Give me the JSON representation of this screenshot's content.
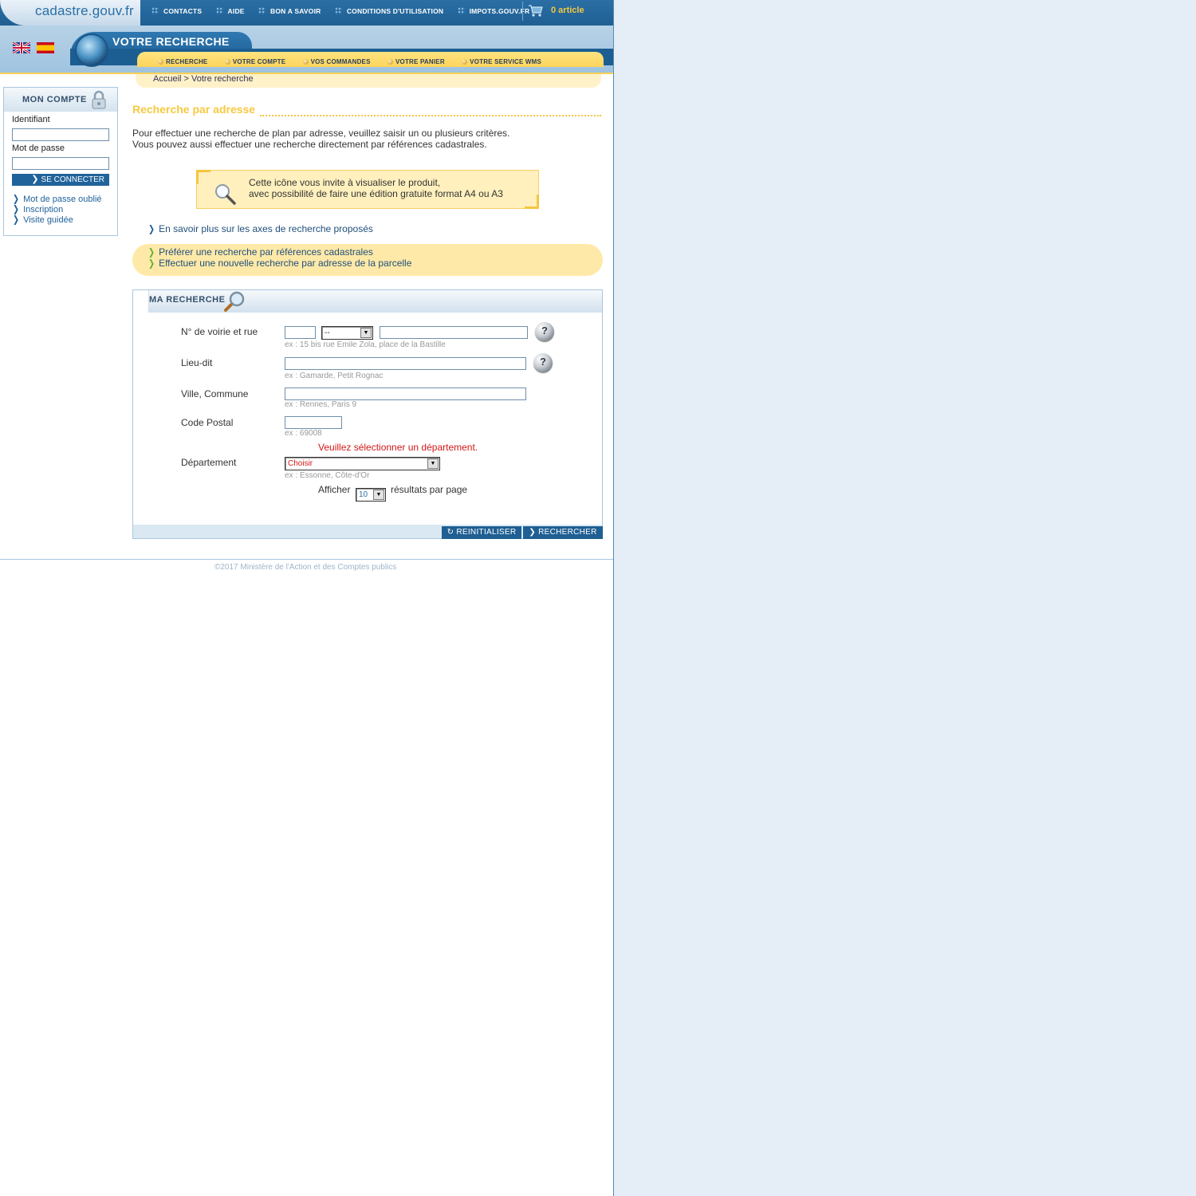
{
  "header": {
    "logo": "cadastre.gouv.fr",
    "top_nav": [
      "CONTACTS",
      "AIDE",
      "BON A SAVOIR",
      "CONDITIONS D'UTILISATION",
      "IMPOTS.GOUV.FR"
    ],
    "cart": "0 article",
    "section_title": "VOTRE RECHERCHE",
    "main_nav": [
      "RECHERCHE",
      "VOTRE COMPTE",
      "VOS COMMANDES",
      "VOTRE PANIER",
      "VOTRE SERVICE WMS"
    ],
    "breadcrumb": "Accueil > Votre recherche",
    "languages": [
      "English",
      "Español"
    ]
  },
  "account": {
    "title": "MON COMPTE",
    "id_label": "Identifiant",
    "id_value": "",
    "password_label": "Mot de passe",
    "password_value": "",
    "login_button": "SE CONNECTER",
    "links": [
      "Mot de passe oublié",
      "Inscription",
      "Visite guidée"
    ]
  },
  "main": {
    "title": "Recherche par adresse",
    "intro_line1": "Pour effectuer une recherche de plan par adresse, veuillez saisir un ou plusieurs critères.",
    "intro_line2": "Vous pouvez aussi effectuer une recherche directement par références cadastrales.",
    "info_line1": "Cette icône vous invite à visualiser le produit,",
    "info_line2": "avec possibilité de faire une édition gratuite format A4 ou A3",
    "more_link": "En savoir plus sur les axes de recherche proposés",
    "alt_link1": "Préférer une recherche par références cadastrales",
    "alt_link2": "Effectuer une nouvelle recherche par adresse de la parcelle"
  },
  "search": {
    "title": "MA RECHERCHE",
    "street_label": "N° de voirie et rue",
    "street_number_value": "",
    "street_suffix_value": "--",
    "street_name_value": "",
    "street_example": "ex : 15 bis rue Emile Zola, place de la Bastille",
    "lieudit_label": "Lieu-dit",
    "lieudit_value": "",
    "lieudit_example": "ex : Gamarde, Petit Rognac",
    "city_label": "Ville, Commune",
    "city_value": "",
    "city_example": "ex : Rennes, Paris 9",
    "postal_label": "Code Postal",
    "postal_value": "",
    "postal_example": "ex : 69008",
    "dept_error": "Veuillez sélectionner un département.",
    "dept_label": "Département",
    "dept_value": "Choisir",
    "dept_example": "ex : Essonne, Côte-d'Or",
    "show_label": "Afficher",
    "per_page_value": "10",
    "per_page_suffix": "résultats par page",
    "reset_button": "REINITIALISER",
    "search_button": "RECHERCHER",
    "help_glyph": "?"
  },
  "footer": {
    "copyright": "©2017 Ministère de l'Action et des Comptes publics"
  },
  "colors": {
    "brand_blue": "#1f5f93",
    "accent_yellow": "#f7c940",
    "error_red": "#d21717"
  }
}
